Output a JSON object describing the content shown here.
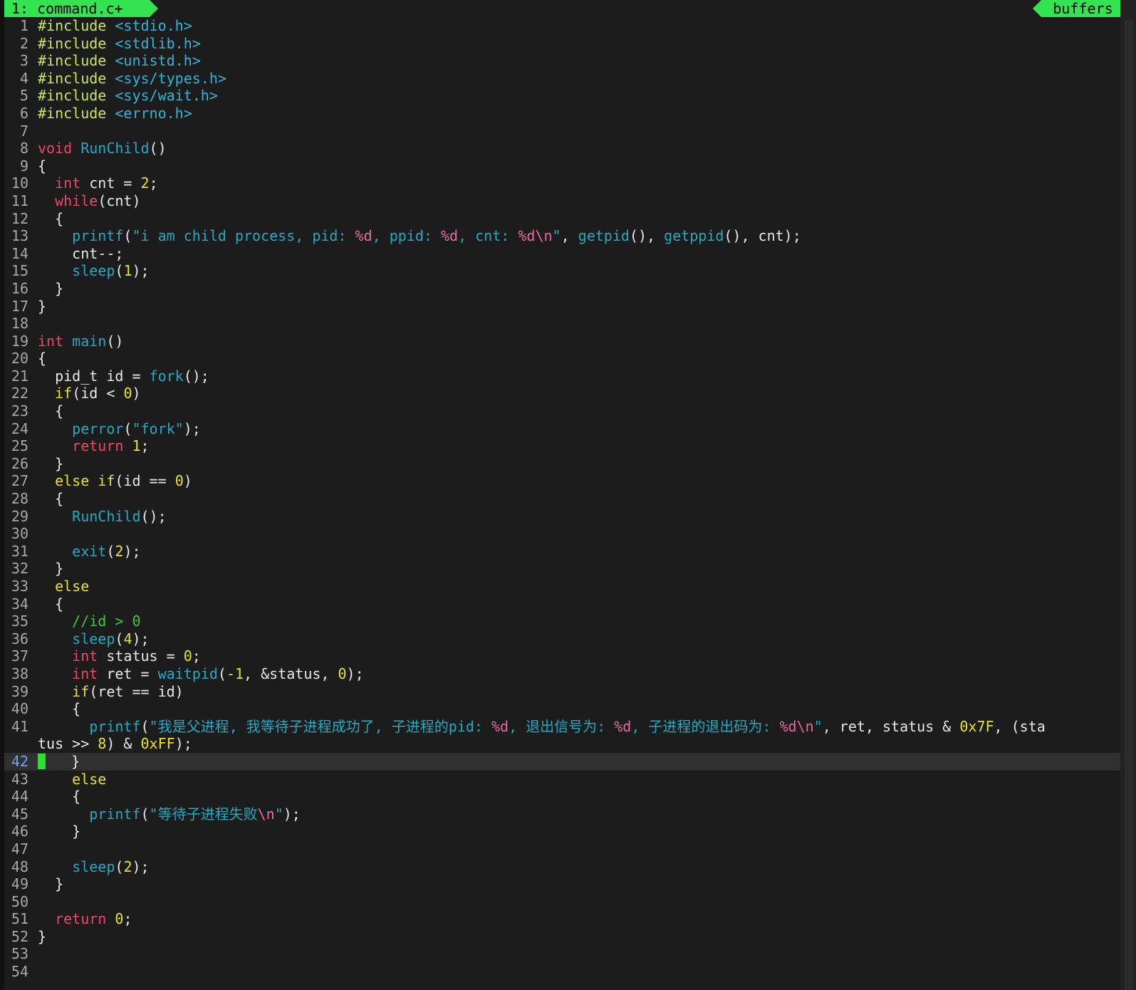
{
  "editor": {
    "tab_label": "1: command.c+",
    "buffers_label": "buffers",
    "current_line": 42,
    "cursor_line_number": "42",
    "lines": [
      {
        "n": "1",
        "t": [
          [
            "pp",
            "#include "
          ],
          [
            "hdr",
            "<stdio.h>"
          ]
        ]
      },
      {
        "n": "2",
        "t": [
          [
            "pp",
            "#include "
          ],
          [
            "hdr",
            "<stdlib.h>"
          ]
        ]
      },
      {
        "n": "3",
        "t": [
          [
            "pp",
            "#include "
          ],
          [
            "hdr",
            "<unistd.h>"
          ]
        ]
      },
      {
        "n": "4",
        "t": [
          [
            "pp",
            "#include "
          ],
          [
            "hdr",
            "<sys/types.h>"
          ]
        ]
      },
      {
        "n": "5",
        "t": [
          [
            "pp",
            "#include "
          ],
          [
            "hdr",
            "<sys/wait.h>"
          ]
        ]
      },
      {
        "n": "6",
        "t": [
          [
            "pp",
            "#include "
          ],
          [
            "hdr",
            "<errno.h>"
          ]
        ]
      },
      {
        "n": "7",
        "t": []
      },
      {
        "n": "8",
        "t": [
          [
            "ty",
            "void "
          ],
          [
            "fn",
            "RunChild"
          ],
          [
            "plain",
            "()"
          ]
        ]
      },
      {
        "n": "9",
        "t": [
          [
            "plain",
            "{"
          ]
        ]
      },
      {
        "n": "10",
        "t": [
          [
            "plain",
            "  "
          ],
          [
            "ty",
            "int"
          ],
          [
            "plain",
            " cnt = "
          ],
          [
            "num",
            "2"
          ],
          [
            "plain",
            ";"
          ]
        ]
      },
      {
        "n": "11",
        "t": [
          [
            "plain",
            "  "
          ],
          [
            "kw",
            "while"
          ],
          [
            "plain",
            "(cnt)"
          ]
        ]
      },
      {
        "n": "12",
        "t": [
          [
            "plain",
            "  {"
          ]
        ]
      },
      {
        "n": "13",
        "t": [
          [
            "plain",
            "    "
          ],
          [
            "fn",
            "printf"
          ],
          [
            "plain",
            "("
          ],
          [
            "str",
            "\"i am child process, pid: "
          ],
          [
            "fmt",
            "%d"
          ],
          [
            "str",
            ", ppid: "
          ],
          [
            "fmt",
            "%d"
          ],
          [
            "str",
            ", cnt: "
          ],
          [
            "fmt",
            "%d\\n"
          ],
          [
            "str",
            "\""
          ],
          [
            "plain",
            ", "
          ],
          [
            "fn",
            "getpid"
          ],
          [
            "plain",
            "(), "
          ],
          [
            "fn",
            "getppid"
          ],
          [
            "plain",
            "(), cnt);"
          ]
        ]
      },
      {
        "n": "14",
        "t": [
          [
            "plain",
            "    cnt--;"
          ]
        ]
      },
      {
        "n": "15",
        "t": [
          [
            "plain",
            "    "
          ],
          [
            "fn",
            "sleep"
          ],
          [
            "plain",
            "("
          ],
          [
            "num",
            "1"
          ],
          [
            "plain",
            ");"
          ]
        ]
      },
      {
        "n": "16",
        "t": [
          [
            "plain",
            "  }"
          ]
        ]
      },
      {
        "n": "17",
        "t": [
          [
            "plain",
            "}"
          ]
        ]
      },
      {
        "n": "18",
        "t": []
      },
      {
        "n": "19",
        "t": [
          [
            "ty",
            "int "
          ],
          [
            "fn",
            "main"
          ],
          [
            "plain",
            "()"
          ]
        ]
      },
      {
        "n": "20",
        "t": [
          [
            "plain",
            "{"
          ]
        ]
      },
      {
        "n": "21",
        "t": [
          [
            "plain",
            "  pid_t id = "
          ],
          [
            "fn",
            "fork"
          ],
          [
            "plain",
            "();"
          ]
        ]
      },
      {
        "n": "22",
        "t": [
          [
            "plain",
            "  "
          ],
          [
            "ctl",
            "if"
          ],
          [
            "plain",
            "(id < "
          ],
          [
            "num",
            "0"
          ],
          [
            "plain",
            ")"
          ]
        ]
      },
      {
        "n": "23",
        "t": [
          [
            "plain",
            "  {"
          ]
        ]
      },
      {
        "n": "24",
        "t": [
          [
            "plain",
            "    "
          ],
          [
            "fn",
            "perror"
          ],
          [
            "plain",
            "("
          ],
          [
            "str",
            "\"fork\""
          ],
          [
            "plain",
            ");"
          ]
        ]
      },
      {
        "n": "25",
        "t": [
          [
            "plain",
            "    "
          ],
          [
            "kw",
            "return "
          ],
          [
            "num",
            "1"
          ],
          [
            "plain",
            ";"
          ]
        ]
      },
      {
        "n": "26",
        "t": [
          [
            "plain",
            "  }"
          ]
        ]
      },
      {
        "n": "27",
        "t": [
          [
            "plain",
            "  "
          ],
          [
            "ctl",
            "else if"
          ],
          [
            "plain",
            "(id == "
          ],
          [
            "num",
            "0"
          ],
          [
            "plain",
            ")"
          ]
        ]
      },
      {
        "n": "28",
        "t": [
          [
            "plain",
            "  {"
          ]
        ]
      },
      {
        "n": "29",
        "t": [
          [
            "plain",
            "    "
          ],
          [
            "fn",
            "RunChild"
          ],
          [
            "plain",
            "();"
          ]
        ]
      },
      {
        "n": "30",
        "t": []
      },
      {
        "n": "31",
        "t": [
          [
            "plain",
            "    "
          ],
          [
            "fn",
            "exit"
          ],
          [
            "plain",
            "("
          ],
          [
            "num",
            "2"
          ],
          [
            "plain",
            ");"
          ]
        ]
      },
      {
        "n": "32",
        "t": [
          [
            "plain",
            "  }"
          ]
        ]
      },
      {
        "n": "33",
        "t": [
          [
            "plain",
            "  "
          ],
          [
            "ctl",
            "else"
          ]
        ]
      },
      {
        "n": "34",
        "t": [
          [
            "plain",
            "  {"
          ]
        ]
      },
      {
        "n": "35",
        "t": [
          [
            "plain",
            "    "
          ],
          [
            "cmt",
            "//id > 0"
          ]
        ]
      },
      {
        "n": "36",
        "t": [
          [
            "plain",
            "    "
          ],
          [
            "fn",
            "sleep"
          ],
          [
            "plain",
            "("
          ],
          [
            "num",
            "4"
          ],
          [
            "plain",
            ");"
          ]
        ]
      },
      {
        "n": "37",
        "t": [
          [
            "plain",
            "    "
          ],
          [
            "ty",
            "int"
          ],
          [
            "plain",
            " status = "
          ],
          [
            "num",
            "0"
          ],
          [
            "plain",
            ";"
          ]
        ]
      },
      {
        "n": "38",
        "t": [
          [
            "plain",
            "    "
          ],
          [
            "ty",
            "int"
          ],
          [
            "plain",
            " ret = "
          ],
          [
            "fn",
            "waitpid"
          ],
          [
            "plain",
            "("
          ],
          [
            "num",
            "-1"
          ],
          [
            "plain",
            ", &status, "
          ],
          [
            "num",
            "0"
          ],
          [
            "plain",
            ");"
          ]
        ]
      },
      {
        "n": "39",
        "t": [
          [
            "plain",
            "    "
          ],
          [
            "ctl",
            "if"
          ],
          [
            "plain",
            "(ret == id)"
          ]
        ]
      },
      {
        "n": "40",
        "t": [
          [
            "plain",
            "    {"
          ]
        ]
      },
      {
        "n": "41",
        "t": [
          [
            "plain",
            "      "
          ],
          [
            "fn",
            "printf"
          ],
          [
            "plain",
            "("
          ],
          [
            "str",
            "\"我是父进程, 我等待子进程成功了, 子进程的pid: "
          ],
          [
            "fmt",
            "%d"
          ],
          [
            "str",
            ", 退出信号为: "
          ],
          [
            "fmt",
            "%d"
          ],
          [
            "str",
            ", 子进程的退出码为: "
          ],
          [
            "fmt",
            "%d\\n"
          ],
          [
            "str",
            "\""
          ],
          [
            "plain",
            ", ret, status & "
          ],
          [
            "num",
            "0x7F"
          ],
          [
            "plain",
            ", (sta"
          ]
        ]
      },
      {
        "n": "",
        "t": [
          [
            "plain",
            "tus >> "
          ],
          [
            "num",
            "8"
          ],
          [
            "plain",
            ") & "
          ],
          [
            "num",
            "0xFF"
          ],
          [
            "plain",
            ");"
          ]
        ]
      },
      {
        "n": "42",
        "t": [
          [
            "plain",
            "    }"
          ]
        ],
        "current": true
      },
      {
        "n": "43",
        "t": [
          [
            "plain",
            "    "
          ],
          [
            "ctl",
            "else"
          ]
        ]
      },
      {
        "n": "44",
        "t": [
          [
            "plain",
            "    {"
          ]
        ]
      },
      {
        "n": "45",
        "t": [
          [
            "plain",
            "      "
          ],
          [
            "fn",
            "printf"
          ],
          [
            "plain",
            "("
          ],
          [
            "str",
            "\"等待子进程失败"
          ],
          [
            "fmt",
            "\\n"
          ],
          [
            "str",
            "\""
          ],
          [
            "plain",
            ");"
          ]
        ]
      },
      {
        "n": "46",
        "t": [
          [
            "plain",
            "    }"
          ]
        ]
      },
      {
        "n": "47",
        "t": []
      },
      {
        "n": "48",
        "t": [
          [
            "plain",
            "    "
          ],
          [
            "fn",
            "sleep"
          ],
          [
            "plain",
            "("
          ],
          [
            "num",
            "2"
          ],
          [
            "plain",
            ");"
          ]
        ]
      },
      {
        "n": "49",
        "t": [
          [
            "plain",
            "  }"
          ]
        ]
      },
      {
        "n": "50",
        "t": []
      },
      {
        "n": "51",
        "t": [
          [
            "plain",
            "  "
          ],
          [
            "kw",
            "return "
          ],
          [
            "num",
            "0"
          ],
          [
            "plain",
            ";"
          ]
        ]
      },
      {
        "n": "52",
        "t": [
          [
            "plain",
            "}"
          ]
        ]
      },
      {
        "n": "53",
        "t": []
      },
      {
        "n": "54",
        "t": []
      }
    ]
  }
}
